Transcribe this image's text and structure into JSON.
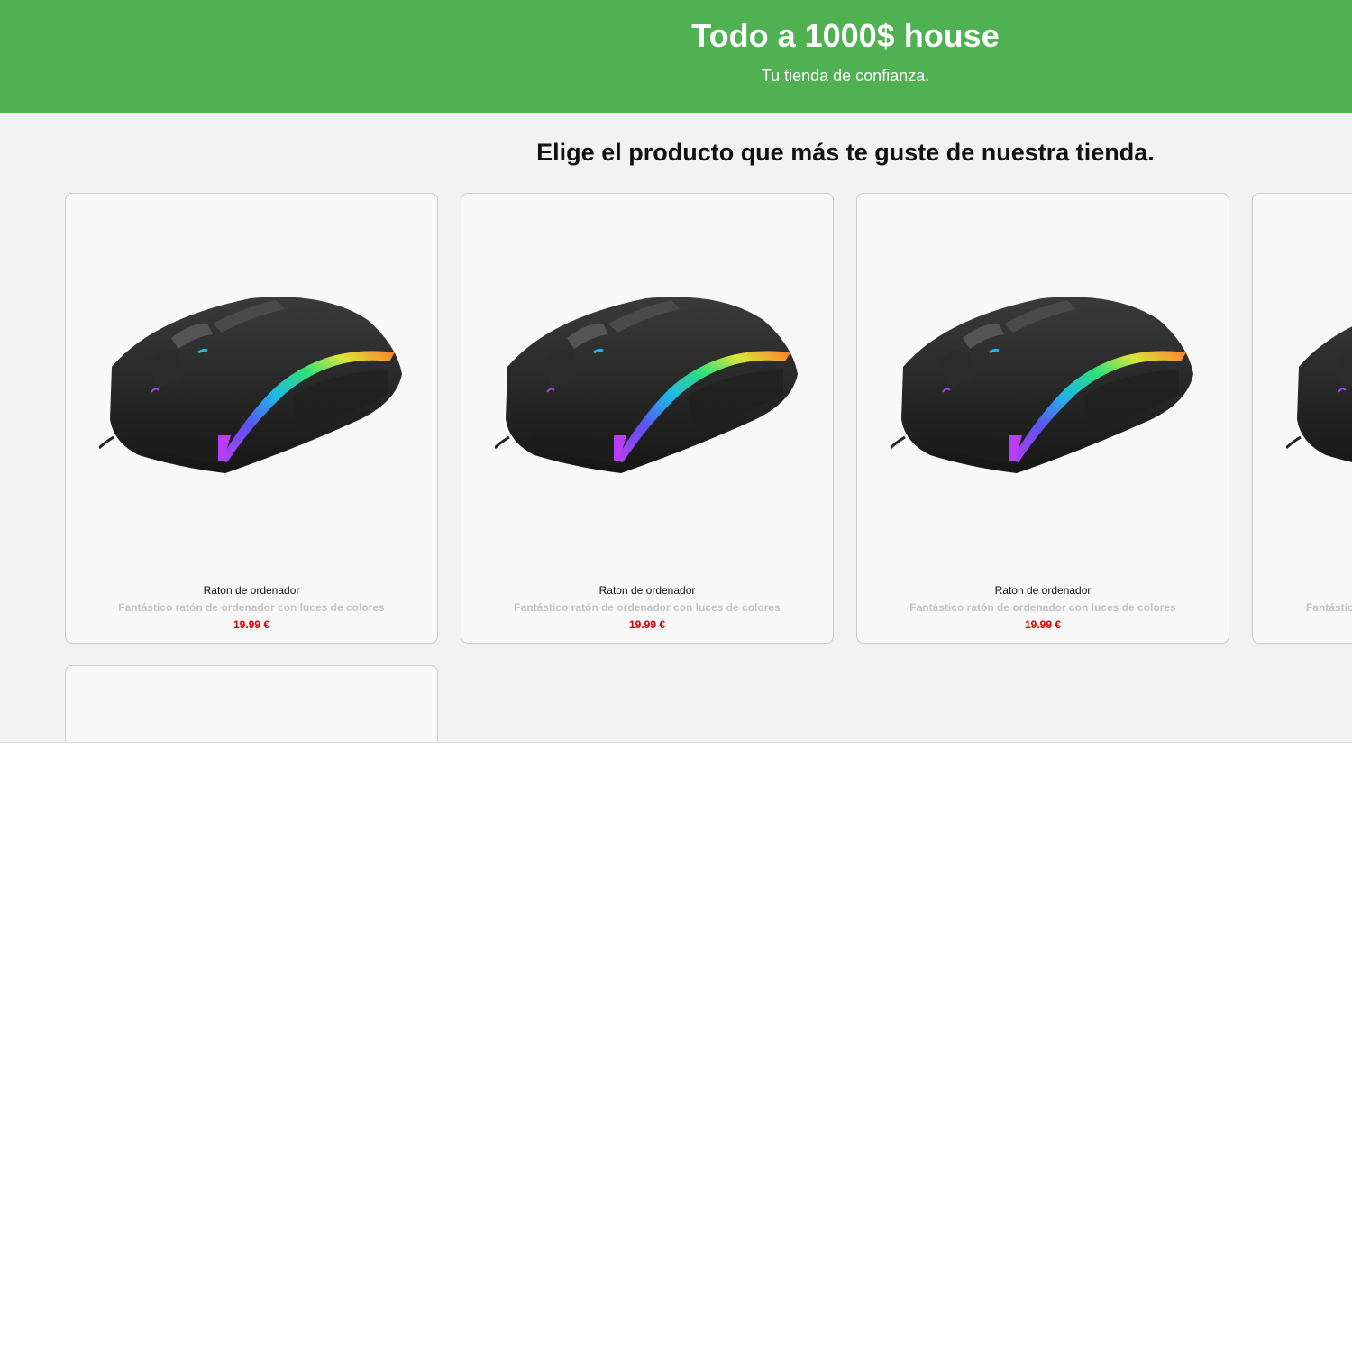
{
  "header": {
    "title": "Todo a 1000$ house",
    "subtitle": "Tu tienda de confianza.",
    "background_color": "#4fb152"
  },
  "main": {
    "heading": "Elige el producto que más te guste de nuestra tienda."
  },
  "products": [
    {
      "name": "Raton de ordenador",
      "description": "Fantástico ratón de ordenador con luces de colores",
      "price": "19.99 €",
      "image": "rgb-gaming-mouse"
    },
    {
      "name": "Raton de ordenador",
      "description": "Fantástico ratón de ordenador con luces de colores",
      "price": "19.99 €",
      "image": "rgb-gaming-mouse"
    },
    {
      "name": "Raton de ordenador",
      "description": "Fantástico ratón de ordenador con luces de colores",
      "price": "19.99 €",
      "image": "rgb-gaming-mouse"
    },
    {
      "name": "",
      "description": "Fantástic",
      "price": "",
      "image": "rgb-gaming-mouse"
    },
    {
      "name": "",
      "description": "",
      "price": "",
      "image": ""
    }
  ],
  "colors": {
    "price": "#d40000",
    "description": "#c6c6c6",
    "page_background": "#f2f2f2"
  }
}
